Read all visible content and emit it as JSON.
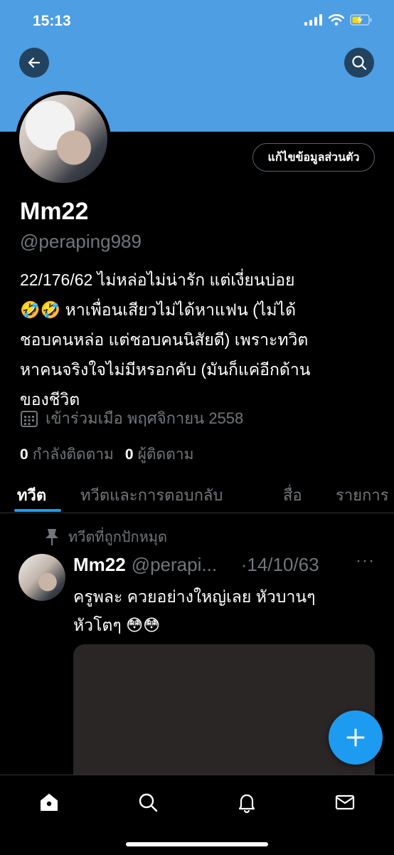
{
  "status_bar": {
    "time": "15:13"
  },
  "header": {
    "back_icon": "arrow-left-icon",
    "search_icon": "search-icon"
  },
  "profile": {
    "edit_button_label": "แก้ไขข้อมูลส่วนตัว",
    "display_name": "Mm22",
    "handle": "@peraping989",
    "bio": "22/176/62 ไม่หล่อไม่น่ารัก แต่เงี่ยนบ่อย\n🤣🤣 หาเพื่อนเสียวไม่ได้หาแฟน (ไม่ได้\nชอบคนหล่อ แต่ชอบคนนิสัยดี) เพราะทวิต\nหาคนจริงใจไม่มีหรอกคับ (มันก็แค่อีกด้าน\nของชีวิต",
    "joined": "เข้าร่วมเมือ พฤศจิกายน 2558",
    "following_count": "0",
    "following_label": "กำลังติดตาม",
    "followers_count": "0",
    "followers_label": "ผู้ติดตาม"
  },
  "tabs": [
    {
      "label": "ทวีต"
    },
    {
      "label": "ทวีตและการตอบกลับ"
    },
    {
      "label": "สื่อ"
    },
    {
      "label": "รายการ"
    }
  ],
  "pinned_tweet": {
    "pinned_label": "ทวีตที่ถูกปักหมุด",
    "name": "Mm22",
    "handle": "@perapi...",
    "date": "·14/10/63",
    "more": "···",
    "text": "ครูพละ ควยอย่างใหญ่เลย หัวบานๆ\nหัวโตๆ 😳😳"
  },
  "colors": {
    "accent": "#1d9bf0",
    "banner": "#4d9ee2",
    "secondary_text": "#71767b"
  }
}
